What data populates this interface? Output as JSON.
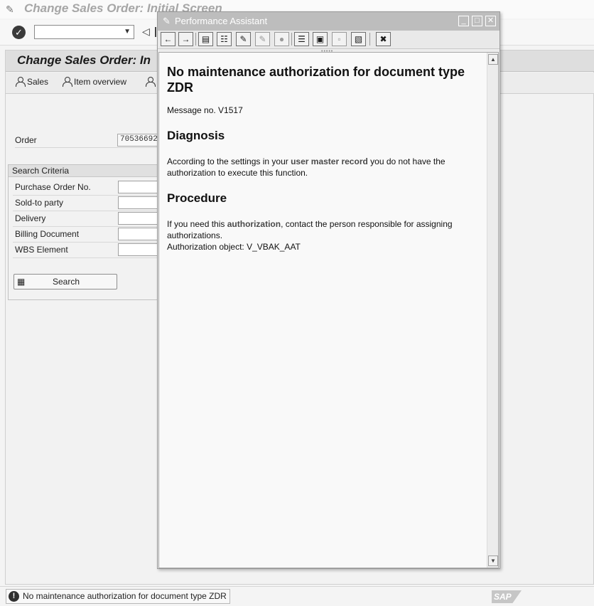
{
  "window": {
    "title": "Change Sales Order: Initial Screen"
  },
  "screen": {
    "title": "Change Sales Order: In"
  },
  "app_toolbar": {
    "sales_label": "Sales",
    "item_overview_label": "Item overview"
  },
  "order": {
    "label": "Order",
    "value": "70536692"
  },
  "search_criteria": {
    "title": "Search Criteria",
    "fields": [
      {
        "label": "Purchase Order No."
      },
      {
        "label": "Sold-to party"
      },
      {
        "label": "Delivery"
      },
      {
        "label": "Billing Document"
      },
      {
        "label": "WBS Element"
      }
    ],
    "search_label": "Search"
  },
  "status": {
    "message": "No maintenance authorization for document type ZDR",
    "logo": "SAP"
  },
  "popup": {
    "title": "Performance Assistant",
    "window_controls": {
      "minimize": "_",
      "maximize": "□",
      "close": "✕"
    },
    "toolbar_icons": [
      "back-arrow-icon",
      "forward-arrow-icon",
      "book-icon",
      "structure-icon",
      "edit-icon",
      "comment-icon",
      "person-icon",
      "list-icon",
      "notes-icon",
      "print-preview-icon",
      "print-icon",
      "close-icon"
    ],
    "heading": "No maintenance authorization for document type ZDR",
    "message_no": "Message no. V1517",
    "diagnosis_heading": "Diagnosis",
    "diagnosis_pre": "According to the settings in your ",
    "diagnosis_link": "user master record",
    "diagnosis_post": " you do not have the authorization to execute this function.",
    "procedure_heading": "Procedure",
    "procedure_pre": "If you need this ",
    "procedure_link": "authorization",
    "procedure_post": ", contact the person responsible for assigning authorizations.",
    "auth_object": "Authorization object: V_VBAK_AAT"
  }
}
